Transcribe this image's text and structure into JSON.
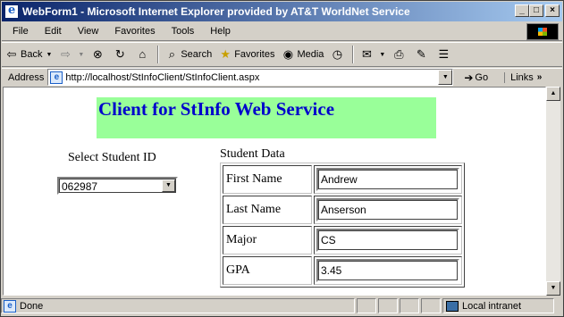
{
  "window": {
    "title": "WebForm1 - Microsoft Internet Explorer provided by AT&T WorldNet Service",
    "controls": {
      "minimize": "_",
      "maximize": "□",
      "close": "×"
    }
  },
  "menu": [
    "File",
    "Edit",
    "View",
    "Favorites",
    "Tools",
    "Help"
  ],
  "toolbar": {
    "back_label": "Back",
    "search_label": "Search",
    "favorites_label": "Favorites",
    "media_label": "Media"
  },
  "address": {
    "label": "Address",
    "url": "http://localhost/StInfoClient/StInfoClient.aspx",
    "go_label": "Go",
    "links_label": "Links"
  },
  "page": {
    "heading": "Client for StInfo Web Service",
    "heading_color": "#0000cc",
    "banner_color": "#99ff99",
    "select_label": "Select Student ID",
    "selected_id": "062987",
    "student_data_label": "Student Data",
    "fields": [
      {
        "label": "First Name",
        "value": "Andrew"
      },
      {
        "label": "Last Name",
        "value": "Anserson"
      },
      {
        "label": "Major",
        "value": "CS"
      },
      {
        "label": "GPA",
        "value": "3.45"
      }
    ]
  },
  "status": {
    "text": "Done",
    "zone": "Local intranet"
  }
}
